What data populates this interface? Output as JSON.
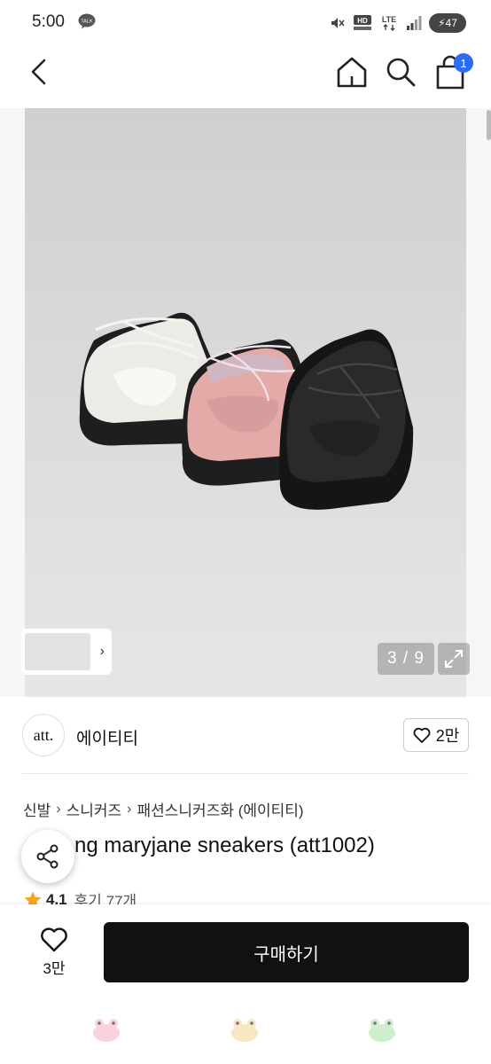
{
  "status_bar": {
    "time": "5:00",
    "talk_label": "TALK",
    "battery": "47"
  },
  "header": {
    "cart_count": "1"
  },
  "gallery": {
    "counter": "3 / 9"
  },
  "brand": {
    "logo_text": "att.",
    "name": "에이티티",
    "like_count": "2만"
  },
  "breadcrumb": [
    "신발",
    "스니커즈",
    "패션스니커즈화 (에이티티)"
  ],
  "product": {
    "title": "ng maryjane sneakers (att1002)",
    "rating": "4.1",
    "review_label": "후기 77개"
  },
  "bottom_bar": {
    "wish_count": "3만",
    "buy_label": "구매하기"
  },
  "colors": {
    "accent": "#2c6cf5",
    "buy_button": "#111111",
    "star": "#f5a623"
  }
}
